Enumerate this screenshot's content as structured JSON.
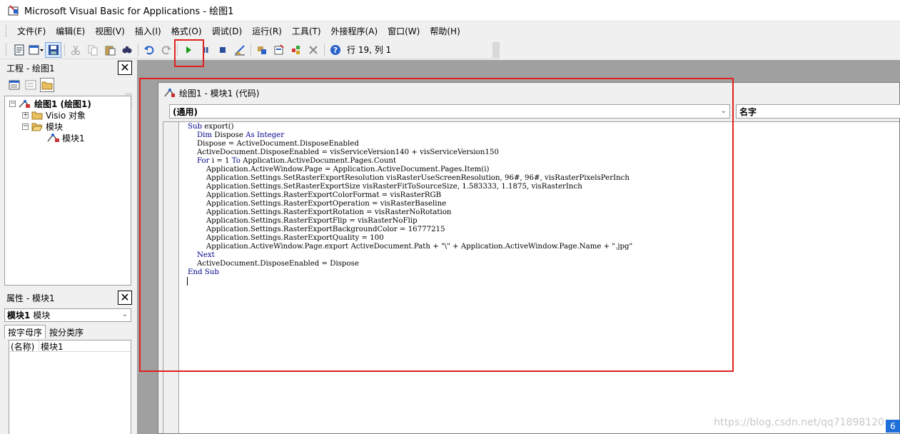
{
  "window": {
    "title": "Microsoft Visual Basic for Applications - 绘图1"
  },
  "menu": [
    "文件(F)",
    "编辑(E)",
    "视图(V)",
    "插入(I)",
    "格式(O)",
    "调试(D)",
    "运行(R)",
    "工具(T)",
    "外接程序(A)",
    "窗口(W)",
    "帮助(H)"
  ],
  "toolbar": {
    "cursor_position": "行 19, 列 1",
    "icons": [
      "view-visio-icon",
      "insert-userform-icon",
      "save-icon",
      "cut-icon",
      "copy-icon",
      "paste-icon",
      "find-icon",
      "undo-icon",
      "redo-icon",
      "run-icon",
      "break-icon",
      "reset-icon",
      "design-mode-icon",
      "project-explorer-icon",
      "properties-window-icon",
      "object-browser-icon",
      "toolbox-icon",
      "help-icon"
    ]
  },
  "project": {
    "header": "工程 - 绘图1",
    "close": "✕",
    "tree": [
      {
        "label": "绘图1 (绘图1)",
        "bold": true
      },
      {
        "label": "Visio 对象"
      },
      {
        "label": "模块"
      },
      {
        "label": "模块1"
      }
    ]
  },
  "properties": {
    "header": "属性 - 模块1",
    "close": "✕",
    "object_name": "模块1",
    "object_type": "模块",
    "tabs": [
      "按字母序",
      "按分类序"
    ],
    "rows": [
      {
        "key": "(名称)",
        "value": "模块1"
      }
    ]
  },
  "code_window": {
    "title": "绘图1 - 模块1 (代码)",
    "object_combo": "(通用)",
    "proc_combo": "名字",
    "lines": [
      "Sub export()",
      "    Dim Dispose As Integer",
      "    Dispose = ActiveDocument.DisposeEnabled",
      "    ActiveDocument.DisposeEnabled = visServiceVersion140 + visServiceVersion150",
      "    For i = 1 To Application.ActiveDocument.Pages.Count",
      "        Application.ActiveWindow.Page = Application.ActiveDocument.Pages.Item(i)",
      "        Application.Settings.SetRasterExportResolution visRasterUseScreenResolution, 96#, 96#, visRasterPixelsPerInch",
      "        Application.Settings.SetRasterExportSize visRasterFitToSourceSize, 1.583333, 1.1875, visRasterInch",
      "        Application.Settings.RasterExportColorFormat = visRasterRGB",
      "        Application.Settings.RasterExportOperation = visRasterBaseline",
      "        Application.Settings.RasterExportRotation = visRasterNoRotation",
      "        Application.Settings.RasterExportFlip = visRasterNoFlip",
      "        Application.Settings.RasterExportBackgroundColor = 16777215",
      "        Application.Settings.RasterExportQuality = 100",
      "        Application.ActiveWindow.Page.export ActiveDocument.Path + \"\\\" + Application.ActiveWindow.Page.Name + \".jpg\"",
      "    Next",
      "    ActiveDocument.DisposeEnabled = Dispose",
      "End Sub"
    ]
  },
  "watermark": "https://blog.csdn.net/qq71898120",
  "corner_badge": "6",
  "colors": {
    "highlight": "#e02020",
    "keyword": "#00008b",
    "run_green": "#1a9a1a"
  }
}
